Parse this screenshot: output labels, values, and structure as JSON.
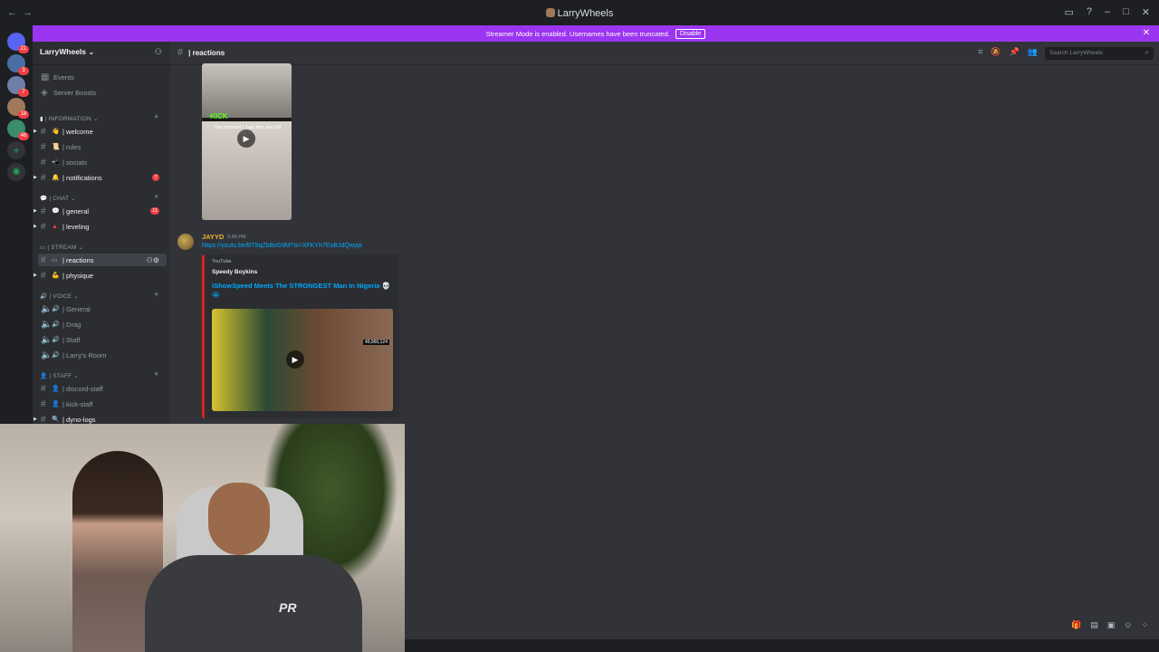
{
  "titlebar": {
    "title": "LarryWheels"
  },
  "servers": [
    {
      "badge": "21"
    },
    {
      "badge": "3"
    },
    {
      "badge": "7"
    },
    {
      "badge": "18"
    },
    {
      "badge": "46"
    }
  ],
  "banner": {
    "text": "Streamer Mode is enabled. Usernames have been truncated.",
    "button": "Disable"
  },
  "guild": {
    "name": "LarryWheels ⌄"
  },
  "sidebar": {
    "events": "Events",
    "boosts": "Server Boosts",
    "categories": {
      "information": "| INFORMATION ⌄",
      "chat": "| CHAT ⌄",
      "stream": "| STREAM ⌄",
      "voice": "| VOICE ⌄",
      "staff": "| STAFF ⌄"
    },
    "channels": {
      "welcome": "| welcome",
      "rules": "| rules",
      "socials": "| socials",
      "notifications": "| notifications",
      "notifications_badge": "7",
      "general": "| general",
      "general_badge": "11",
      "leveling": "| leveling",
      "reactions": "| reactions",
      "physique": "| physique",
      "voice_general": "| General",
      "drag": "| Drag",
      "staff": "| Staff",
      "larrys_room": "| Larry's Room",
      "discord_staff": "| discord-staff",
      "kick_staff": "| kick-staff",
      "dyno_logs": "| dyno-logs"
    }
  },
  "header": {
    "channel": "| reactions",
    "search_placeholder": "Search LarryWheels"
  },
  "messages": [
    {
      "thumb_badge": "KICK",
      "thumb_caption": "The moment I said this she left my car"
    },
    {
      "author": "JAYYD",
      "time": "5:49 PM",
      "link": "https://youtu.be/BT8qZb8oG9M?si=XFKYh7EoBJdQwypi",
      "embed": {
        "provider": "YouTube",
        "author": "Speedy Boykins",
        "title": "iShowSpeed Meets The STRONGEST Man In Nigeria 💀😭",
        "views": "49,960,124"
      }
    }
  ],
  "webcam": {
    "shirt_logo": "PR"
  },
  "colors": {
    "banner": "#9b35ef",
    "author": "#f0b232",
    "link": "#00a8fc",
    "embed_border": "#e01e1e",
    "badge": "#f23f43"
  }
}
